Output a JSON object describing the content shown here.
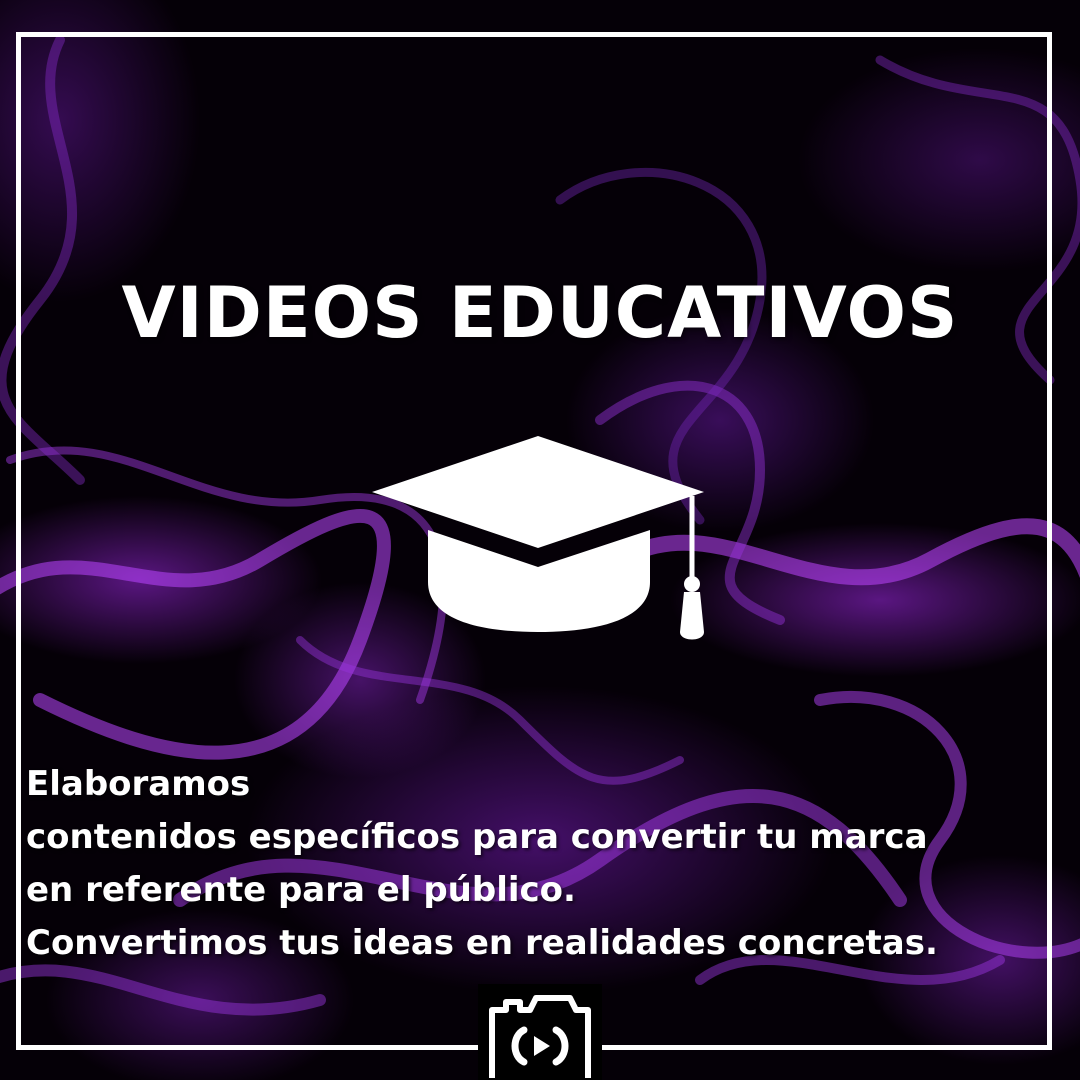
{
  "title": "VIDEOS EDUCATIVOS",
  "body_lines": [
    "Elaboramos",
    "contenidos específicos para convertir tu marca",
    "en referente para el público.",
    "Convertimos tus ideas en realidades concretas."
  ],
  "icons": {
    "main": "graduation-cap-icon",
    "logo": "camera-logo-icon"
  },
  "colors": {
    "smoke": "#9b2be0",
    "background": "#000000",
    "text": "#ffffff"
  }
}
